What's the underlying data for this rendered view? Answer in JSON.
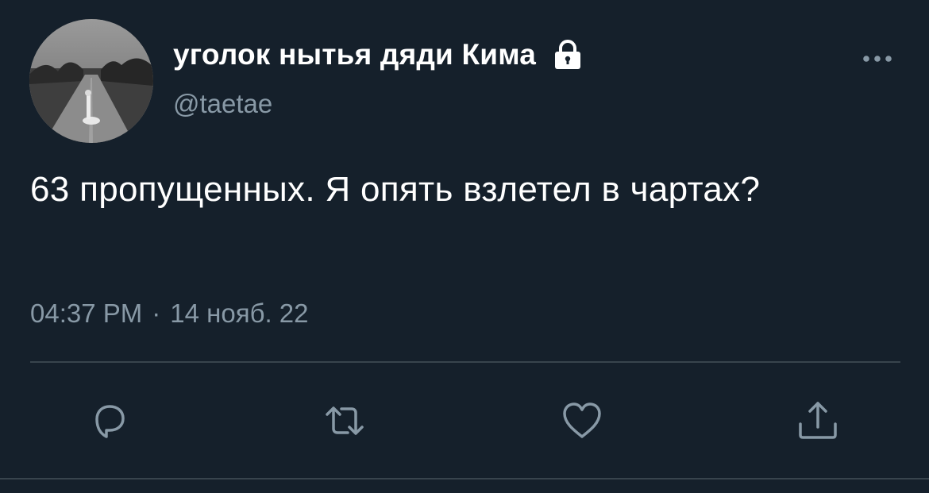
{
  "tweet": {
    "author": {
      "display_name": "уголок нытья дяди Кима",
      "handle": "@taetae",
      "protected_icon": "lock-icon",
      "avatar": "avatar"
    },
    "text": "63 пропущенных. Я опять взлетел в чартах?",
    "time": "04:37 PM",
    "separator": "·",
    "date": "14 нояб. 22",
    "menu_icon": "more-icon"
  },
  "actions": [
    {
      "icon": "reply-icon"
    },
    {
      "icon": "retweet-icon"
    },
    {
      "icon": "like-icon"
    },
    {
      "icon": "share-icon"
    }
  ],
  "colors": {
    "background": "#15202b",
    "primary_text": "#ffffff",
    "secondary_text": "#8899a6",
    "divider": "#38444d"
  }
}
